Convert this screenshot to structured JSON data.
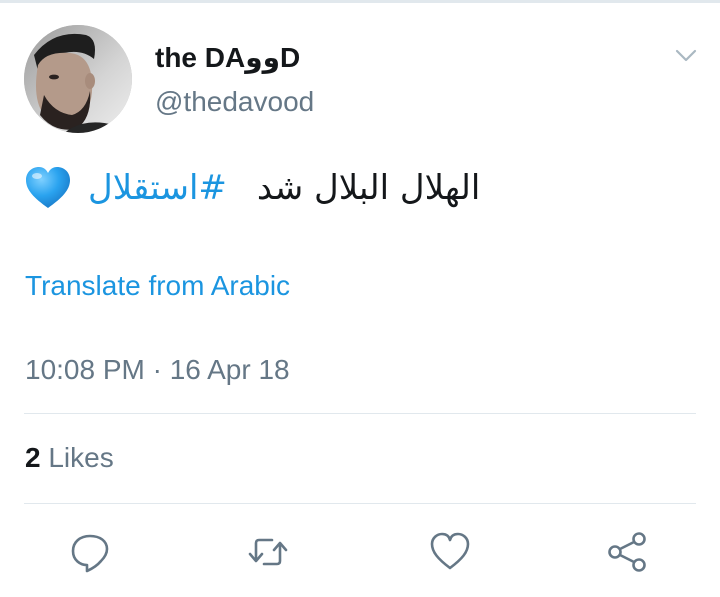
{
  "user": {
    "display_name": "the DAووD",
    "handle": "@thedavood"
  },
  "tweet": {
    "text_words": "الهلال البلال شد",
    "hashtag": "#استقلال",
    "emoji": "blue-heart",
    "translate_link": "Translate from Arabic",
    "timestamp": "10:08 PM · 16 Apr 18"
  },
  "stats": {
    "likes_count": "2",
    "likes_label": "Likes"
  },
  "actions": [
    "reply-icon",
    "retweet-icon",
    "like-icon",
    "share-icon"
  ],
  "colors": {
    "link": "#1b95e0",
    "text": "#14171a",
    "muted": "#657786",
    "divider": "#e1e8ed",
    "heart": "#2aa3ef"
  }
}
